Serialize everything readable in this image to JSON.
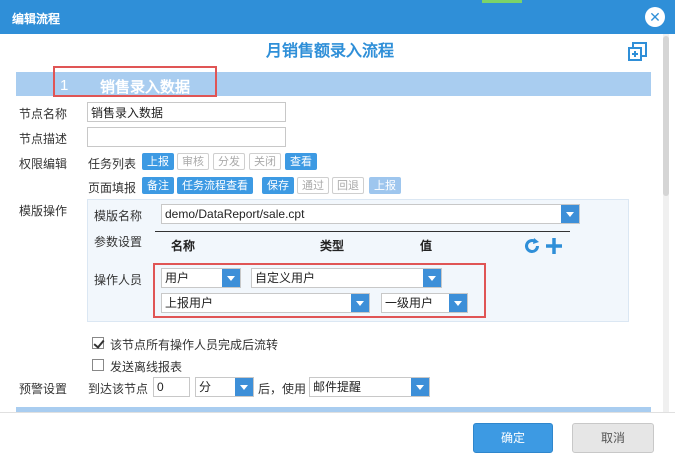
{
  "window": {
    "title": "编辑流程"
  },
  "flow": {
    "title": "月销售额录入流程"
  },
  "section1": {
    "number": "1",
    "name": "销售录入数据"
  },
  "node_name": {
    "label": "节点名称",
    "value": "销售录入数据"
  },
  "node_desc": {
    "label": "节点描述",
    "value": ""
  },
  "perm": {
    "label": "权限编辑",
    "task_list_label": "任务列表",
    "task_buttons": [
      "上报",
      "审核",
      "分发",
      "关闭",
      "查看"
    ],
    "page_fill_label": "页面填报",
    "page_buttons": [
      "备注",
      "任务流程查看",
      "保存",
      "通过",
      "回退",
      "上报"
    ]
  },
  "template": {
    "label": "模版操作",
    "name_label": "模版名称",
    "name_value": "demo/DataReport/sale.cpt",
    "param_label": "参数设置",
    "param_columns": [
      "名称",
      "类型",
      "值"
    ],
    "operator_label": "操作人员",
    "op_select1": "用户",
    "op_select2": "自定义用户",
    "op_select3": "上报用户",
    "op_select4": "一级用户"
  },
  "options": {
    "all_operators_complete": "该节点所有操作人员完成后流转",
    "send_offline": "发送离线报表"
  },
  "alert": {
    "label": "预警设置",
    "reach_label": "到达该节点",
    "value": "0",
    "unit": "分",
    "after_label": "后，使用",
    "method": "邮件提醒"
  },
  "footer": {
    "ok": "确定",
    "cancel": "取消"
  },
  "colors": {
    "accent": "#2f8fd8",
    "section_bg": "#a9cdf0",
    "highlight": "#e05555"
  }
}
